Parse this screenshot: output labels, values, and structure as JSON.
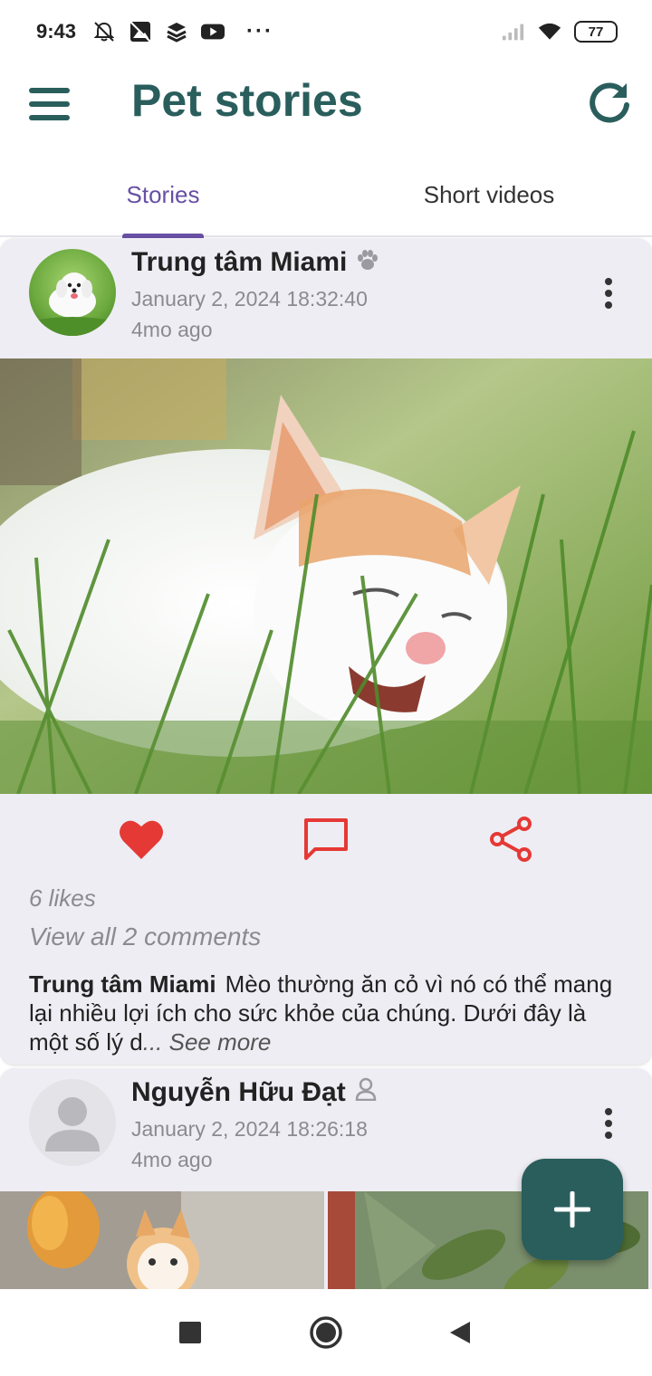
{
  "status_bar": {
    "time": "9:43",
    "overflow": "···",
    "battery": "77",
    "icons": [
      "alarm-off-icon",
      "photo-icon",
      "stack-icon",
      "youtube-icon",
      "signal-icon",
      "wifi-icon",
      "battery-icon"
    ]
  },
  "app_bar": {
    "title": "Pet stories",
    "menu_icon": "menu-icon",
    "refresh_icon": "refresh-icon",
    "title_color": "#2a5e5c"
  },
  "tabs": [
    {
      "label": "Stories",
      "active": true
    },
    {
      "label": "Short videos",
      "active": false
    }
  ],
  "accent_color": "#6750a4",
  "posts": [
    {
      "author": "Trung tâm Miami",
      "author_badge_icon": "paw-icon",
      "date": "January 2, 2024 18:32:40",
      "ago": "4mo ago",
      "likes": "6 likes",
      "comments": "View all 2 comments",
      "caption_author": "Trung tâm Miami",
      "caption_text": "Mèo thường ăn cỏ vì nó có thể mang lại nhiều lợi ích cho sức khỏe của chúng. Dưới đây là một số lý d",
      "see_more": "... See more",
      "liked": true,
      "action_color": "#e53935"
    },
    {
      "author": "Nguyễn Hữu Đạt",
      "author_badge_icon": "person-icon",
      "date": "January 2, 2024 18:26:18",
      "ago": "4mo ago"
    }
  ],
  "fab": {
    "icon": "plus-icon",
    "color": "#2a5e5c"
  },
  "nav_bar": {
    "buttons": [
      "recents-icon",
      "home-icon",
      "back-icon"
    ]
  }
}
